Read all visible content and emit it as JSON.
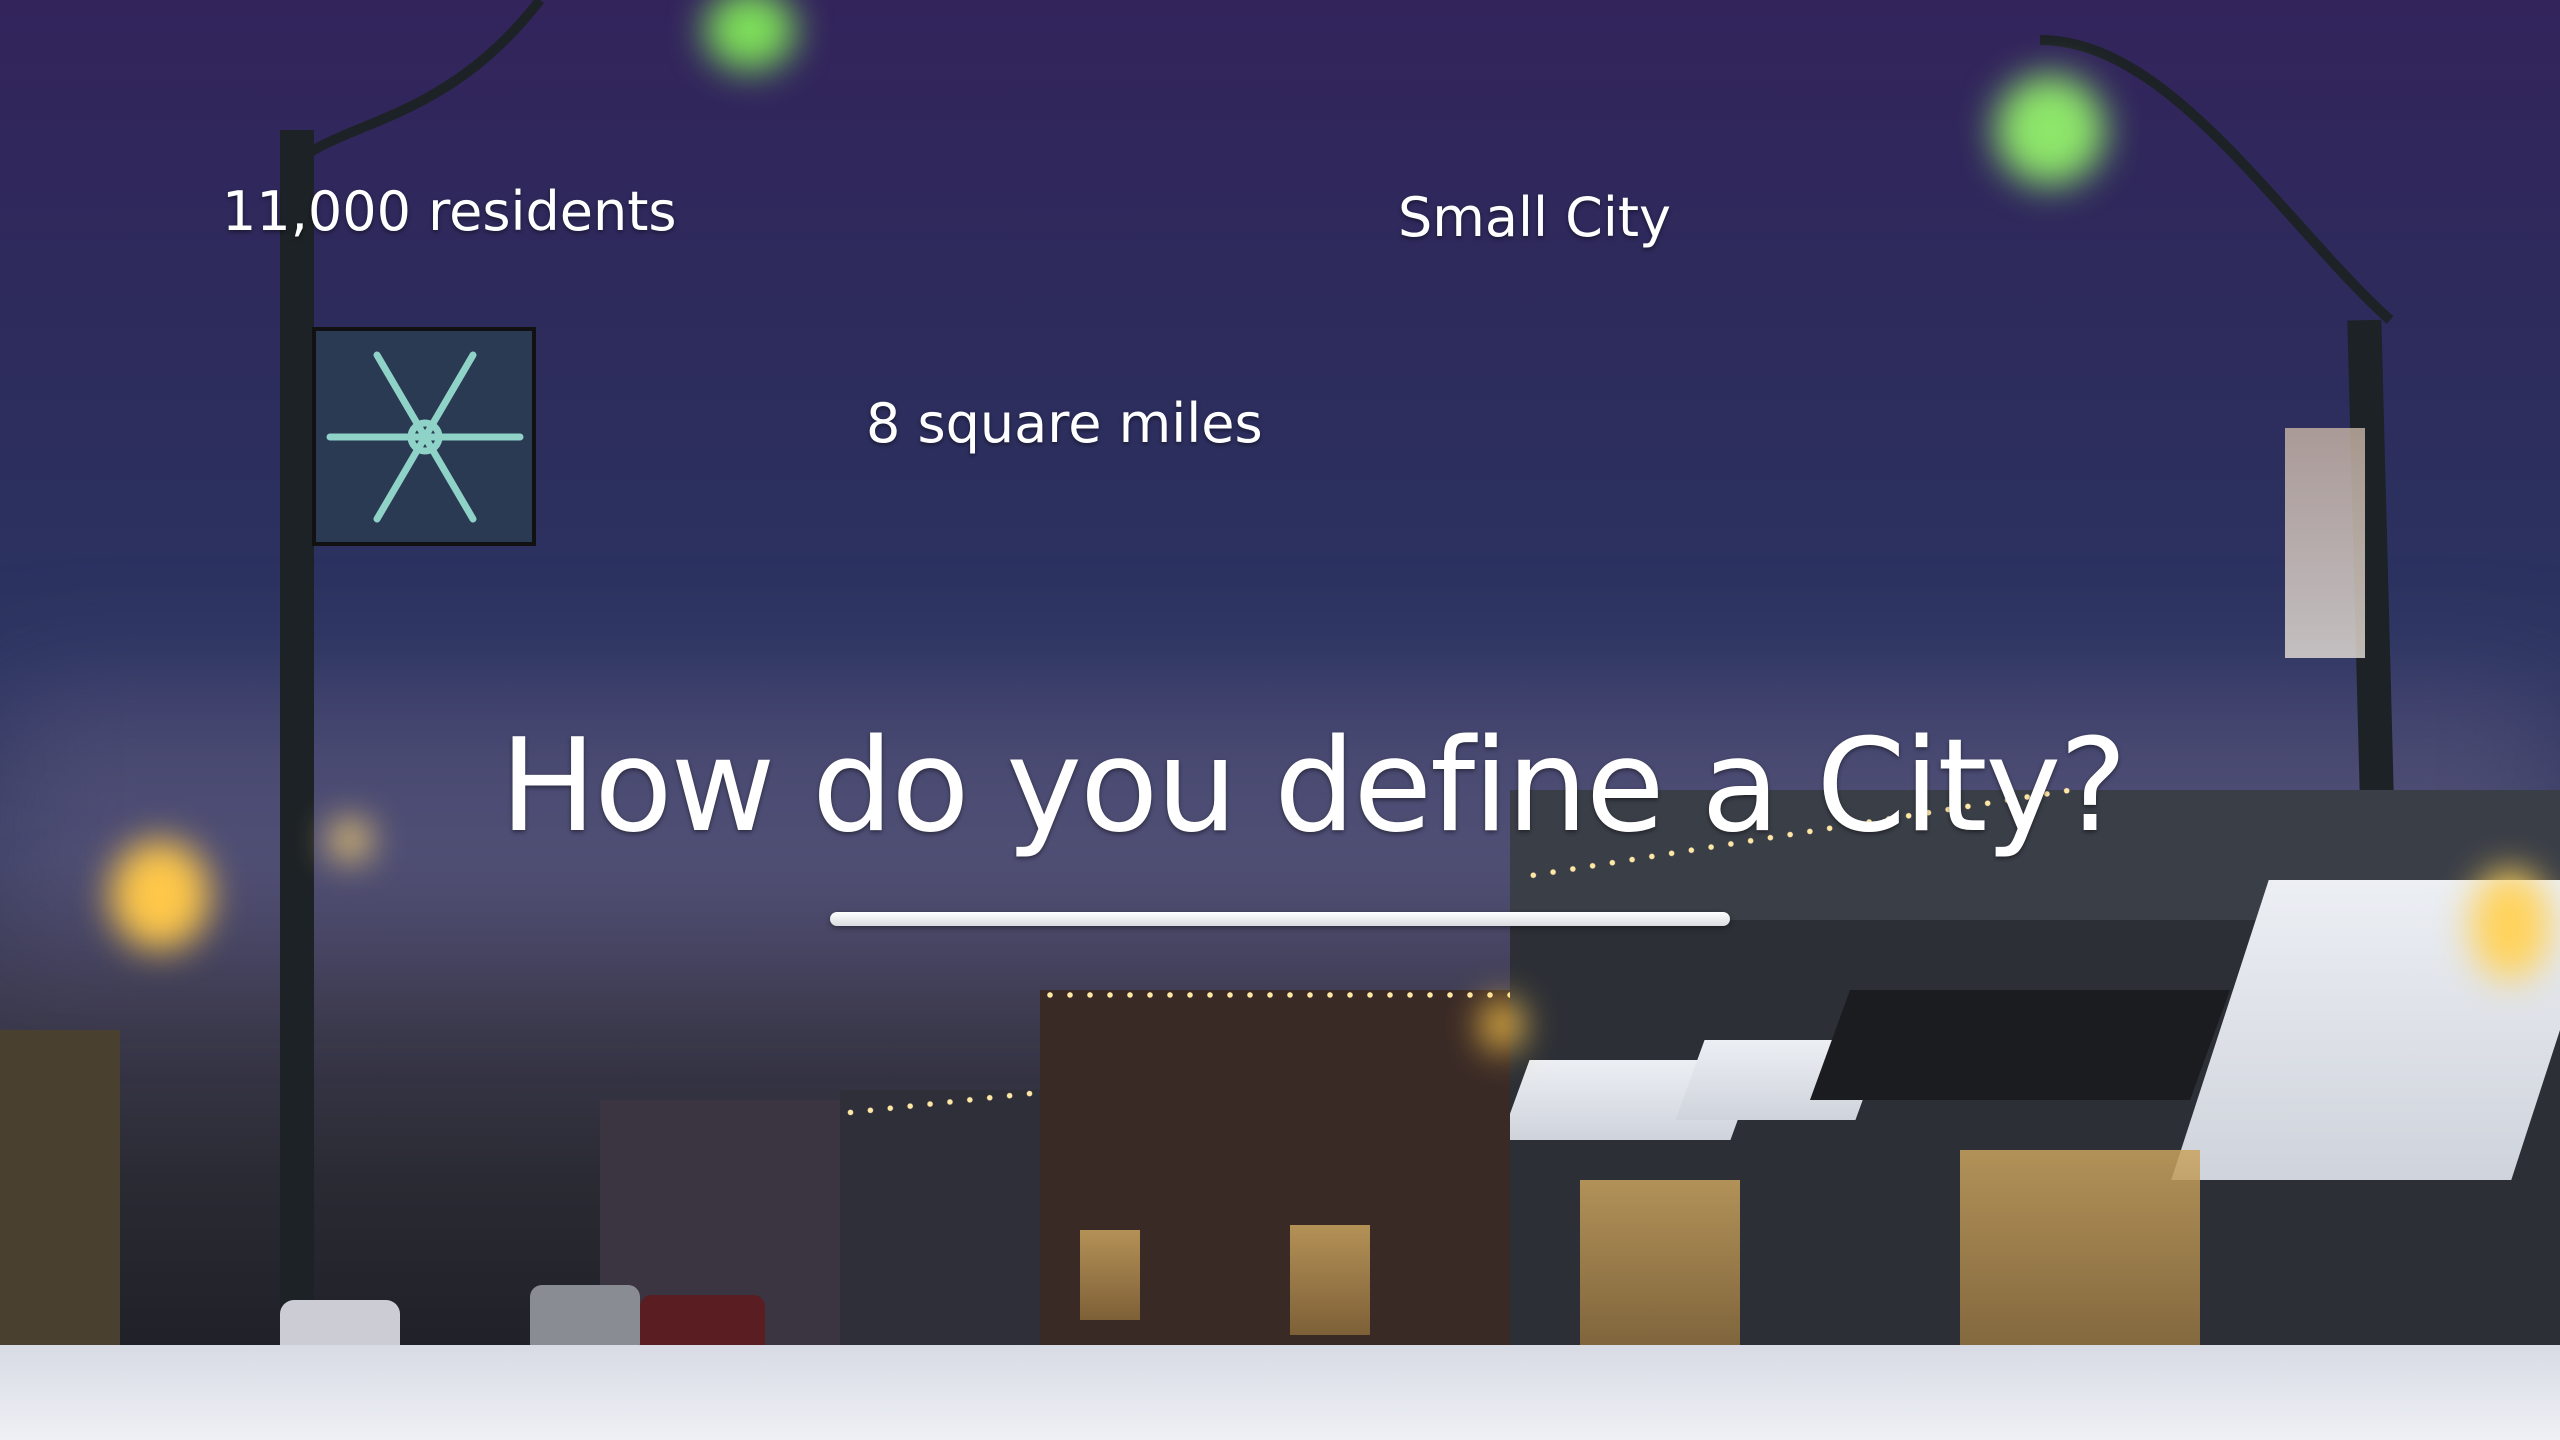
{
  "slide": {
    "title": "How do you define a City?",
    "callouts": [
      {
        "text": "11,000 residents"
      },
      {
        "text": "Small City"
      },
      {
        "text": "8 square miles"
      }
    ]
  },
  "scene": {
    "description_colors": {
      "sky_top": "#33245c",
      "sky_mid": "#2c3461",
      "street_light_green": "#8ee66a",
      "street_light_amber": "#ffc84a",
      "snow": "#e6e9f0"
    },
    "icons": [
      "snowflake-icon",
      "street-lamp-icon"
    ]
  }
}
